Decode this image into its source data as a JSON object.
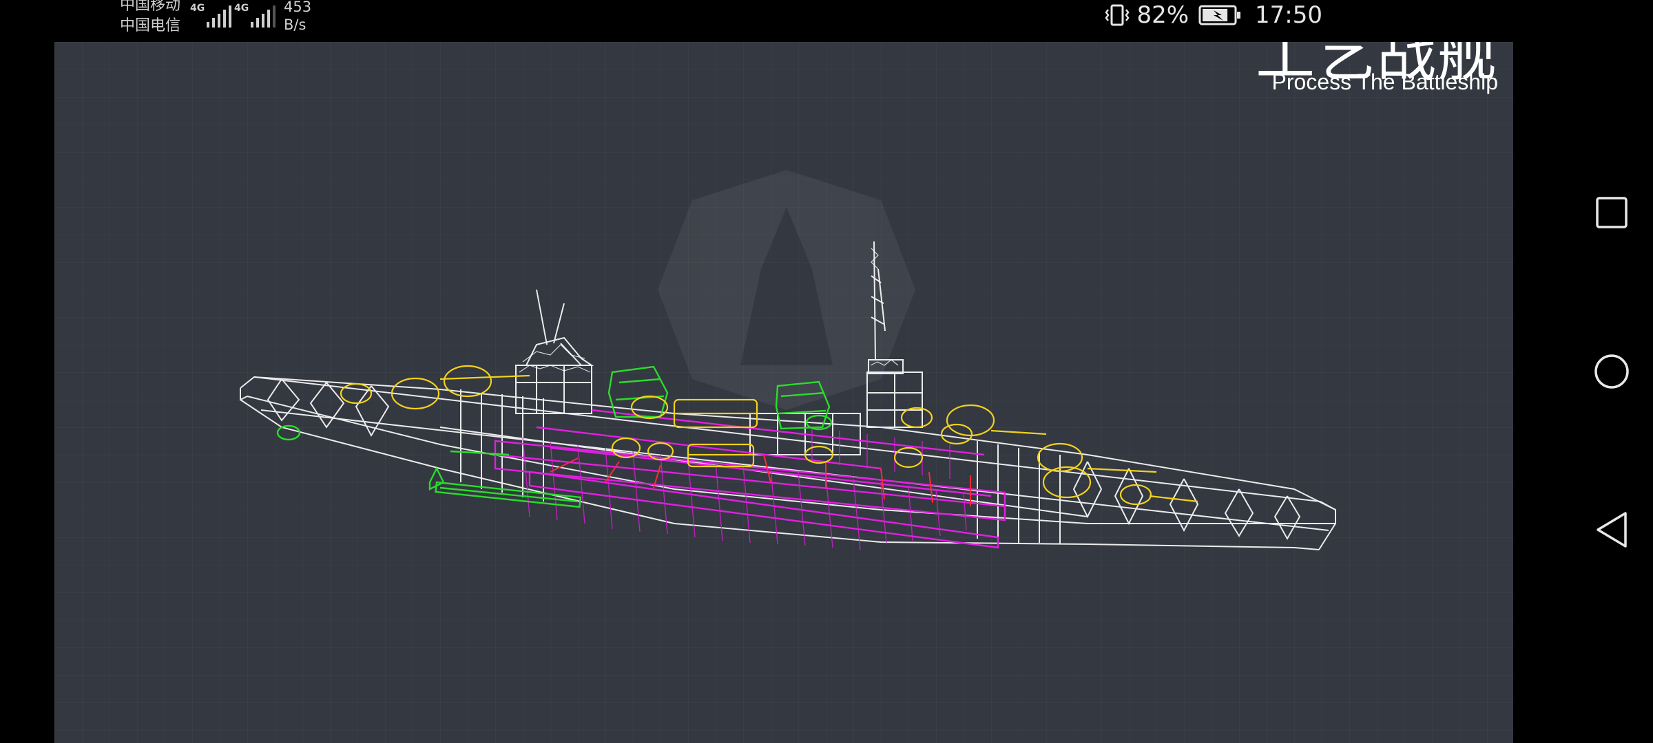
{
  "status_bar": {
    "carrier_1": "中国移动",
    "carrier_2": "中国电信",
    "network_type_1": "4G",
    "network_type_2": "4G",
    "net_speed_value": "453",
    "net_speed_unit": "B/s",
    "battery_percent": "82%",
    "battery_level": 0.82,
    "time": "17:50"
  },
  "game": {
    "title_cn": "工艺战舰",
    "title_en": "Process The Battleship"
  },
  "icons": {
    "vibrate": "vibrate-icon",
    "battery": "battery-charging-icon",
    "recents": "recents-square-icon",
    "home": "home-circle-icon",
    "back": "back-triangle-icon"
  },
  "colors": {
    "viewport_bg": "#343841",
    "hull_wire": "#ffffff",
    "turret_wire": "#f2d21b",
    "module_wire": "#2bdc2b",
    "armor_wire": "#e020e0",
    "internal_wire": "#ff2a3a"
  }
}
